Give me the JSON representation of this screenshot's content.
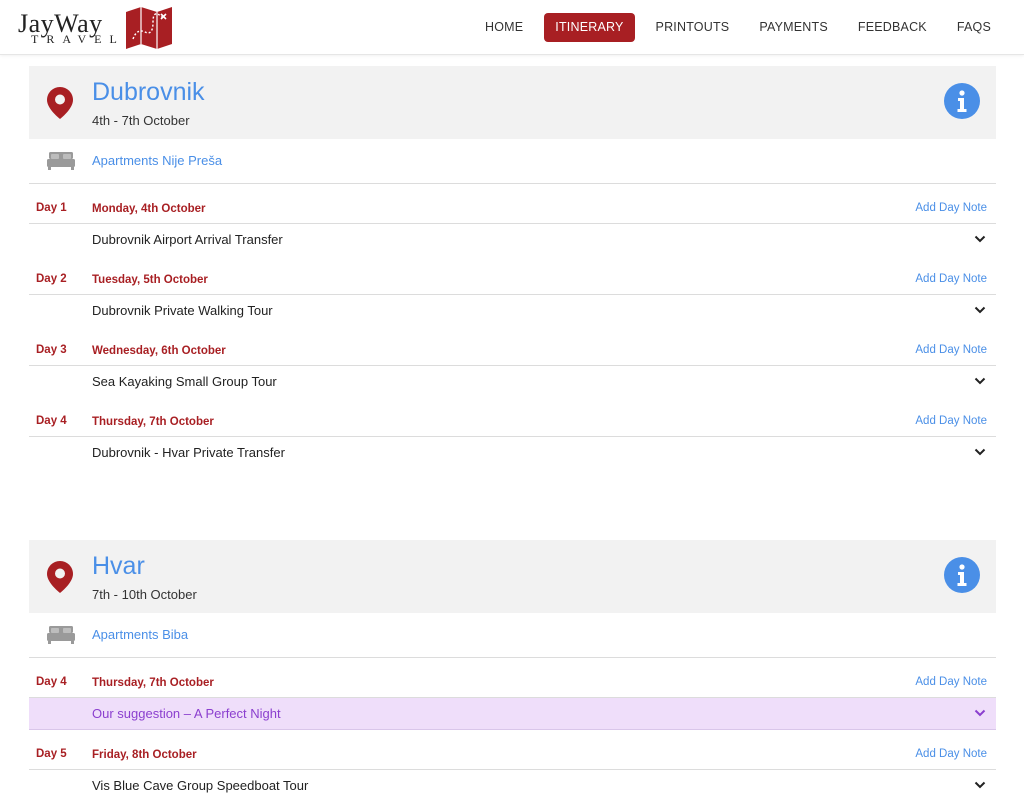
{
  "brand": {
    "name": "JayWay",
    "tagline": "TRAVEL",
    "accent": "#a81f23",
    "link_color": "#4a8fe7",
    "suggestion_bg": "#efdefa"
  },
  "nav": {
    "items": [
      {
        "label": "HOME",
        "active": false
      },
      {
        "label": "ITINERARY",
        "active": true
      },
      {
        "label": "PRINTOUTS",
        "active": false
      },
      {
        "label": "PAYMENTS",
        "active": false
      },
      {
        "label": "FEEDBACK",
        "active": false
      },
      {
        "label": "FAQS",
        "active": false
      }
    ]
  },
  "destinations": [
    {
      "name": "Dubrovnik",
      "dates": "4th - 7th October",
      "accommodation": "Apartments Nije Preša",
      "days": [
        {
          "day": "Day 1",
          "date": "Monday, 4th October",
          "add_note": "Add Day Note",
          "activity": "Dubrovnik Airport Arrival Transfer"
        },
        {
          "day": "Day 2",
          "date": "Tuesday, 5th October",
          "add_note": "Add Day Note",
          "activity": "Dubrovnik Private Walking Tour"
        },
        {
          "day": "Day 3",
          "date": "Wednesday, 6th October",
          "add_note": "Add Day Note",
          "activity": "Sea Kayaking Small Group Tour"
        },
        {
          "day": "Day 4",
          "date": "Thursday, 7th October",
          "add_note": "Add Day Note",
          "activity": "Dubrovnik - Hvar Private Transfer"
        }
      ]
    },
    {
      "name": "Hvar",
      "dates": "7th - 10th October",
      "accommodation": "Apartments Biba",
      "days": [
        {
          "day": "Day 4",
          "date": "Thursday, 7th October",
          "add_note": "Add Day Note",
          "activity": "Our suggestion  – A Perfect Night"
        },
        {
          "day": "Day 5",
          "date": "Friday, 8th October",
          "add_note": "Add Day Note",
          "activity": "Vis Blue Cave Group Speedboat Tour"
        }
      ]
    }
  ]
}
